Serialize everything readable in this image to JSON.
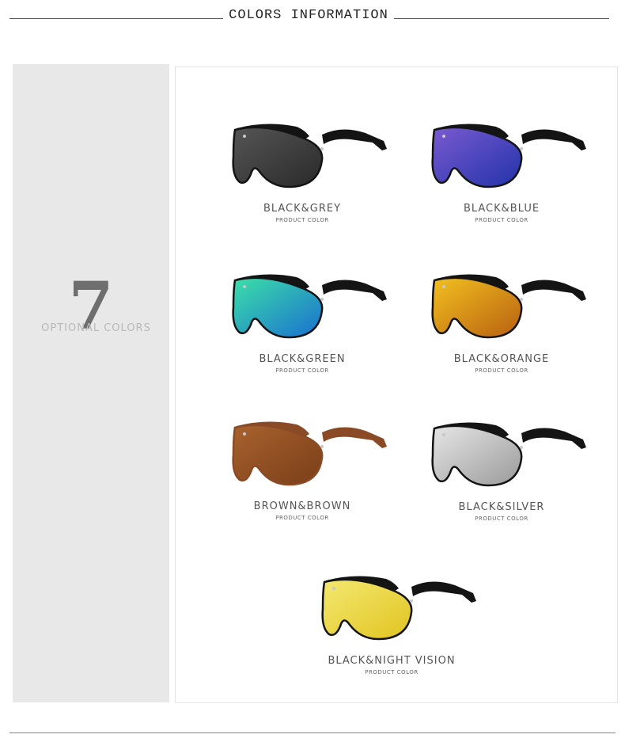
{
  "header": {
    "title": "COLORS INFORMATION"
  },
  "left_panel": {
    "count": "7",
    "label": "OPTIONAL COLORS"
  },
  "products": [
    {
      "name": "BLACK&GREY",
      "sub": "PRODUCT COLOR",
      "frame": "#141414",
      "lens": "#2a2a2a",
      "lens2": "#555555"
    },
    {
      "name": "BLACK&BLUE",
      "sub": "PRODUCT COLOR",
      "frame": "#141414",
      "lens": "#2233aa",
      "lens2": "#7a5ad0"
    },
    {
      "name": "BLACK&GREEN",
      "sub": "PRODUCT COLOR",
      "frame": "#141414",
      "lens": "#1a6fd0",
      "lens2": "#3ce0a8"
    },
    {
      "name": "BLACK&ORANGE",
      "sub": "PRODUCT COLOR",
      "frame": "#141414",
      "lens": "#b86010",
      "lens2": "#f2c020"
    },
    {
      "name": "BROWN&BROWN",
      "sub": "PRODUCT COLOR",
      "frame": "#8a4a26",
      "lens": "#7a3e18",
      "lens2": "#a8622e"
    },
    {
      "name": "BLACK&SILVER",
      "sub": "PRODUCT COLOR",
      "frame": "#141414",
      "lens": "#9a9a9a",
      "lens2": "#e6e6e6"
    },
    {
      "name": "BLACK&NIGHT VISION",
      "sub": "PRODUCT COLOR",
      "frame": "#141414",
      "lens": "#e0c420",
      "lens2": "#f4e870"
    }
  ]
}
